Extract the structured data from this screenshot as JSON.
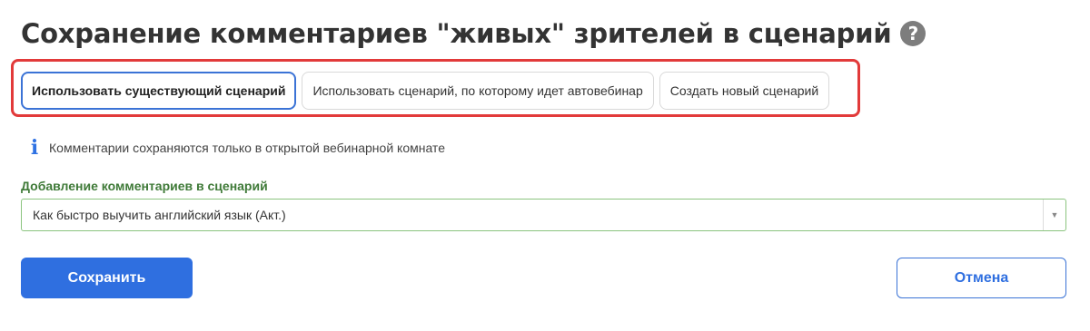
{
  "header": {
    "title": "Сохранение комментариев \"живых\" зрителей в сценарий",
    "help_icon": "question-circle-icon",
    "help_glyph": "?"
  },
  "options": {
    "items": [
      {
        "label": "Использовать существующий сценарий",
        "active": true
      },
      {
        "label": "Использовать сценарий, по которому идет автовебинар",
        "active": false
      },
      {
        "label": "Создать новый сценарий",
        "active": false
      }
    ],
    "highlight_color": "#e23a3a"
  },
  "info": {
    "icon": "info-icon",
    "glyph": "i",
    "text": "Комментарии сохраняются только в открытой вебинарной комнате"
  },
  "field": {
    "label": "Добавление комментариев в сценарий",
    "selected_value": "Как быстро выучить английский язык (Акт.)",
    "arrow_glyph": "▼"
  },
  "actions": {
    "save_label": "Сохранить",
    "cancel_label": "Отмена"
  },
  "colors": {
    "primary": "#2f6fe0",
    "label_green": "#3f7a38",
    "select_border": "#8bc47f",
    "active_tab_border": "#3b73d6"
  }
}
